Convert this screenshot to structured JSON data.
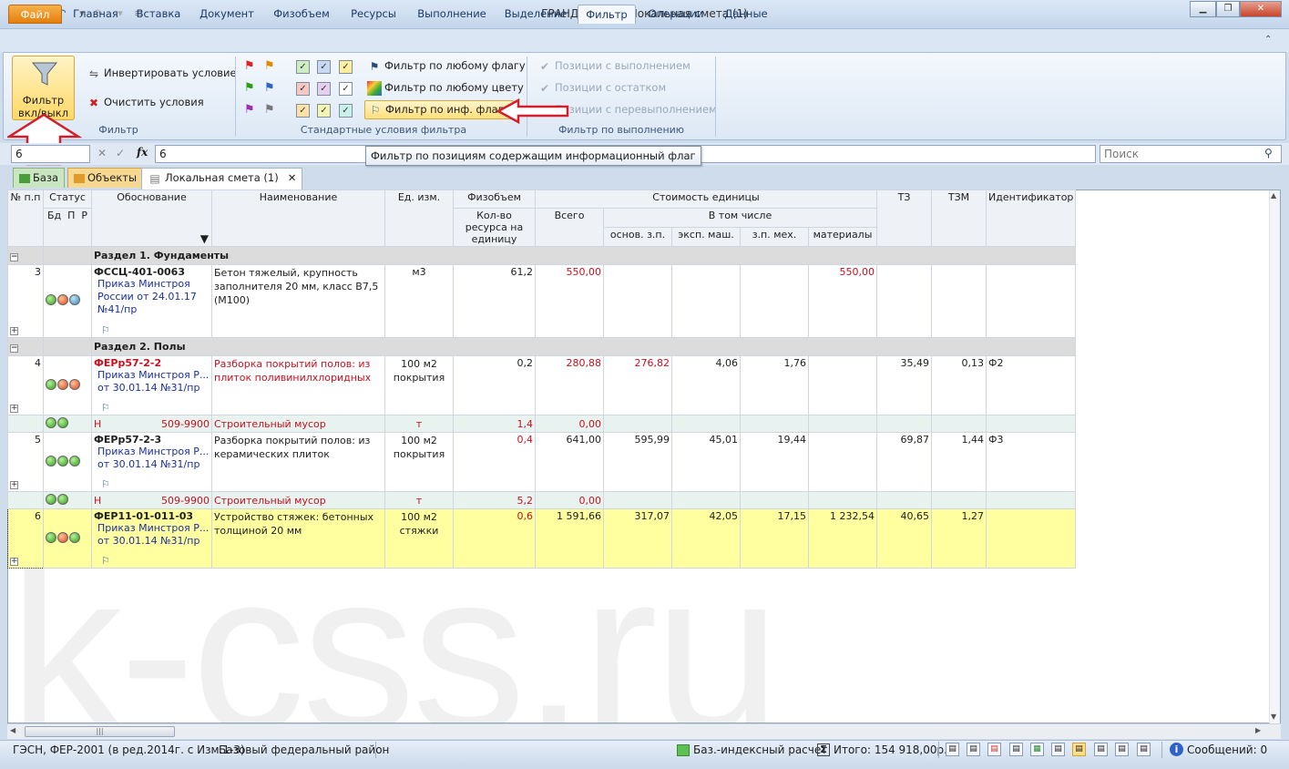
{
  "app": {
    "title": "ГРАНД-Смета - Локальная смета (1)"
  },
  "tabs": [
    "Файл",
    "Главная",
    "Вставка",
    "Документ",
    "Физобъем",
    "Ресурсы",
    "Выполнение",
    "Выделение",
    "Фильтр",
    "Операции",
    "Данные"
  ],
  "ribbon": {
    "filter_toggle": "Фильтр вкл/выкл",
    "invert": "Инвертировать условие",
    "clear": "Очистить условия",
    "group_filter": "Фильтр",
    "by_any_flag": "Фильтр по любому флагу",
    "by_any_color": "Фильтр по любому цвету",
    "by_info_flag": "Фильтр по инф. флагу",
    "group_standard": "Стандартные условия фильтра",
    "with_execution": "Позиции с выполнением",
    "with_remainder": "Позиции с остатком",
    "with_overrun": "Позиции с перевыполнением",
    "group_execution": "Фильтр по выполнению",
    "tooltip": "Фильтр по позициям содержащим информационный флаг"
  },
  "formula": {
    "cell": "6",
    "value": "6",
    "search_placeholder": "Поиск"
  },
  "doc_tabs": {
    "base": "База",
    "objects": "Объекты",
    "estimate": "Локальная смета (1)"
  },
  "grid": {
    "h": {
      "num": "№ п.п",
      "status": "Статус",
      "bd": "Бд",
      "p": "П",
      "r": "Р",
      "basis": "Обоснование",
      "name": "Наименование",
      "unit": "Ед. изм.",
      "phys": "Физобъем",
      "qty": "Кол-во ресурса на единицу",
      "cost": "Стоимость единицы",
      "total": "Всего",
      "incl": "В том числе",
      "zp": "основ. з.п.",
      "mash": "эксп. маш.",
      "mech": "з.п. мех.",
      "mat": "материалы",
      "tz": "ТЗ",
      "tzm": "ТЗМ",
      "ident": "Идентификатор"
    },
    "section1": "Раздел 1. Фундаменты",
    "section2": "Раздел 2. Полы",
    "r3": {
      "n": "3",
      "code": "ФССЦ-401-0063",
      "basis": "Приказ Минстроя России от 24.01.17 №41/пр",
      "name": "Бетон тяжелый, крупность заполнителя 20 мм, класс В7,5 (М100)",
      "unit": "м3",
      "qty": "61,2",
      "total": "550,00",
      "mat": "550,00"
    },
    "r4": {
      "n": "4",
      "code": "ФЕРр57-2-2",
      "basis": "Приказ Минстроя Р... от 30.01.14 №31/пр",
      "name": "Разборка покрытий полов: из плиток поливинилхлоридных",
      "unit": "100 м2 покрытия",
      "qty": "0,2",
      "total": "280,88",
      "zp": "276,82",
      "mash": "4,06",
      "mech": "1,76",
      "tz": "35,49",
      "tzm": "0,13",
      "ident": "Ф2"
    },
    "s4": {
      "h": "Н",
      "code": "509-9900",
      "name": "Строительный мусор",
      "unit": "т",
      "qty": "1,4",
      "total": "0,00"
    },
    "r5": {
      "n": "5",
      "code": "ФЕРр57-2-3",
      "basis": "Приказ Минстроя Р... от 30.01.14 №31/пр",
      "name": "Разборка покрытий полов: из керамических плиток",
      "unit": "100 м2 покрытия",
      "qty": "0,4",
      "total": "641,00",
      "zp": "595,99",
      "mash": "45,01",
      "mech": "19,44",
      "tz": "69,87",
      "tzm": "1,44",
      "ident": "Ф3"
    },
    "s5": {
      "h": "Н",
      "code": "509-9900",
      "name": "Строительный мусор",
      "unit": "т",
      "qty": "5,2",
      "total": "0,00"
    },
    "r6": {
      "n": "6",
      "code": "ФЕР11-01-011-03",
      "basis": "Приказ Минстроя Р... от 30.01.14 №31/пр",
      "name": "Устройство стяжек: бетонных толщиной 20 мм",
      "unit": "100 м2 стяжки",
      "qty": "0,6",
      "total": "1 591,66",
      "zp": "317,07",
      "mash": "42,05",
      "mech": "17,15",
      "mat": "1 232,54",
      "tz": "40,65",
      "tzm": "1,27"
    }
  },
  "watermark": "k-css.ru",
  "status": {
    "norms": "ГЭСН, ФЕР-2001 (в ред.2014г. с Изм.1-3)",
    "region": "Базовый федеральный район",
    "calc": "Баз.-индексный расчет",
    "total": "Итого: 154 918,00р.",
    "messages": "Сообщений: 0"
  }
}
